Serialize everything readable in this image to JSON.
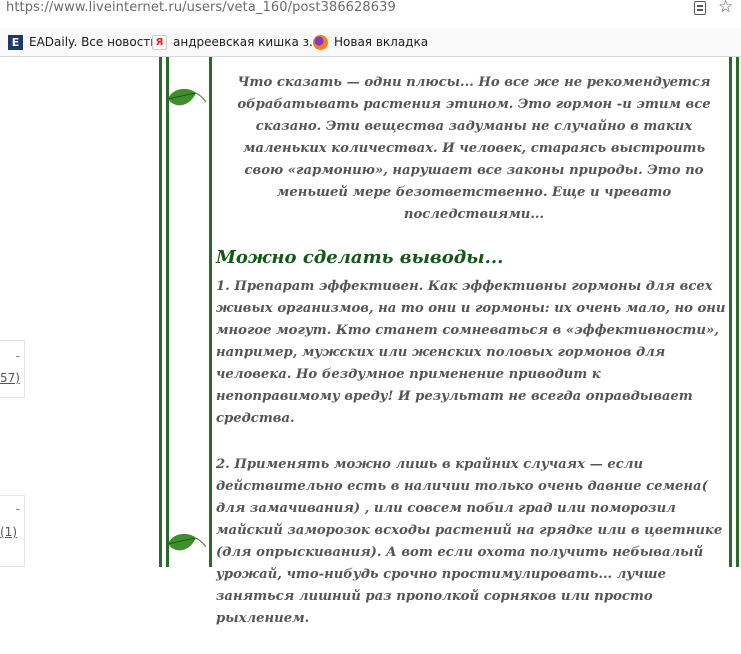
{
  "browser": {
    "url": "https://www.liveinternet.ru/users/veta_160/post386628639",
    "icons": [
      "reader-view-icon",
      "bookmark-star-icon"
    ],
    "bookmarks": [
      {
        "icon": "eadaily-favicon",
        "label": "EADaily. Все новости"
      },
      {
        "icon": "yandex-favicon",
        "label": "андреевская кишка з..."
      },
      {
        "icon": "firefox-icon",
        "label": "Новая вкладка"
      }
    ]
  },
  "sidebar": {
    "items": [
      {
        "dash": "-",
        "count": "57)"
      },
      {
        "dash": "-",
        "count": "(1)"
      }
    ]
  },
  "post": {
    "intro": "Что сказать — одни плюсы... Но все же не рекомендуется обрабатывать растения этином. Это гормон -и этим все сказано. Эти вещества задуманы не случайно в таких маленьких количествах. И человек, стараясь выстроить свою «гармонию», нарушает все законы природы. Это по меньшей мере безответственно. Еще и чревато последствиями...",
    "heading": "Можно сделать выводы...",
    "paragraphs": [
      "1. Препарат эффективен. Как эффективны гормоны для всех живых организмов, на то они и гормоны: их очень мало, но они многое могут. Кто станет сомневаться в «эффективности», например, мужских или женских половых гормонов для человека. Но бездумное применение приводит к непоправимому вреду! И результат не всегда оправдывает средства.",
      "2. Применять можно лишь в крайних случаях — если действительно есть в наличии только очень давние семена( для замачивания) , или совсем побил град или поморозил майский заморозок всходы растений на грядке или в цветнике (для опрыскивания). А вот если охота получить небывалый урожай, что-нибудь срочно простимулировать... лучше заняться лишний раз прополкой сорняков или просто рыхлением."
    ]
  },
  "colors": {
    "frame_green": "#2a6b2a",
    "heading_green": "#0f5a14",
    "text_gray": "#555555"
  }
}
